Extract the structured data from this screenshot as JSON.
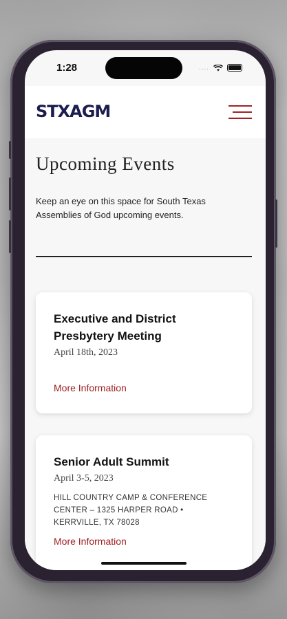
{
  "status_bar": {
    "time": "1:28",
    "signal": "....",
    "wifi": "wifi-icon",
    "battery": "battery-icon"
  },
  "header": {
    "logo": "STXAGM",
    "menu_icon": "hamburger-menu-icon"
  },
  "page": {
    "title": "Upcoming Events",
    "intro": "Keep an eye on this space for South Texas Assemblies of God upcoming events."
  },
  "events": [
    {
      "title": "Executive and District Presbytery Meeting",
      "date": "April 18th, 2023",
      "location": "",
      "link": "More Information"
    },
    {
      "title": "Senior Adult Summit",
      "date": "April 3-5, 2023",
      "location": "HILL COUNTRY CAMP & CONFERENCE CENTER – 1325 HARPER ROAD • KERRVILLE, TX 78028",
      "link": "More Information"
    }
  ],
  "colors": {
    "accent": "#a12024",
    "brand": "#1b1d4f",
    "frame": "#2a2230"
  }
}
